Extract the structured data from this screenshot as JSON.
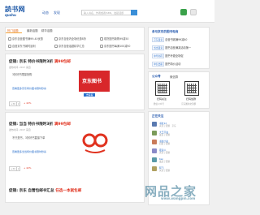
{
  "header": {
    "logo_main": "読书网",
    "logo_sub": "qushu",
    "nav": [
      "动态",
      "发现"
    ],
    "search_placeholder": "输入书名、作者或者ISBN、发起话题"
  },
  "tabs": {
    "active": "热门话题",
    "items": [
      "最新话题",
      "精华话题"
    ],
    "rows": [
      [
        "京东自营图书满99-40优惠",
        "京东自营内全场优惠8折",
        "现货图书新购99减50"
      ],
      [
        "自营京东书城时返利",
        "京东自营话题精华汇总",
        "京东图书每满100减50"
      ]
    ]
  },
  "post1": {
    "title": "促销: 京东 特价书限时3折",
    "title_hl": "满99包邮",
    "meta": "发布时间: 2017  来自",
    "text": "3折好书限量抢购",
    "link": "查看更多京东特价图书限时秒杀",
    "badge": "京东图书",
    "badge_sub": "去看看",
    "votes": [
      "+36",
      "+ 42%"
    ]
  },
  "post2": {
    "title": "促销: 当当 特价书限时3折",
    "title_hl": "满99包邮",
    "meta": "发布时间: 2017  来自",
    "text": "不只是书，3折好书直接下单",
    "link": "查看更多当当特价图书限时秒杀",
    "votes": [
      "+30",
      "+ 42%"
    ]
  },
  "post3": {
    "title": "促销: 京东 自营包邮书汇总",
    "title_hl": "任选一本就包邮"
  },
  "sidebar": {
    "header": "参与京东的图书电商",
    "rows": [
      {
        "tag": "京东自营",
        "text": "自营书城满99减40"
      },
      {
        "tag": "当当自营",
        "text": "图书自营满减活动第一"
      },
      {
        "tag": "中华书局",
        "text": "图书专题全场促"
      },
      {
        "tag": "中信出版",
        "text": "图书特价活动"
      }
    ],
    "follow_head": "公众号",
    "follow_tab": "微信群",
    "qr_labels": [
      "扫码关注",
      "扫码加群"
    ],
    "qr_sub": [
      "微信公众号",
      "京东图书交流群"
    ],
    "users_head": "正在关注",
    "users": [
      {
        "name": "书友12",
        "line": "关注了话题 · 京东"
      },
      {
        "name": "大王不在",
        "line": "发表了话题"
      },
      {
        "name": "书虫小白",
        "line": "回复了话题"
      },
      {
        "name": "夜读人",
        "line": "关注了话题"
      },
      {
        "name": "Ken",
        "line": "发起了话题"
      },
      {
        "name": "阿飞",
        "line": "关注了话题"
      }
    ]
  },
  "watermark": {
    "text": "网品之家",
    "url": "www.wangpin.com"
  }
}
